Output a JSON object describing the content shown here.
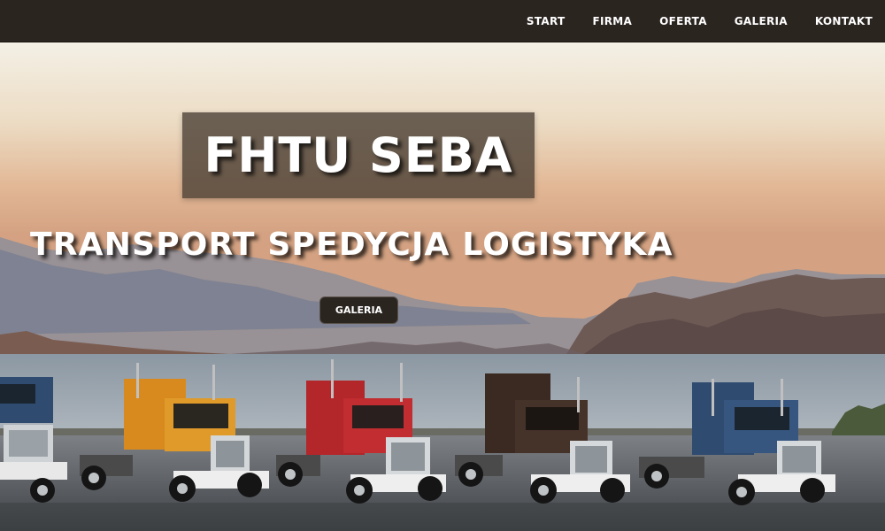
{
  "nav": {
    "items": [
      {
        "label": "START"
      },
      {
        "label": "FIRMA"
      },
      {
        "label": "OFERTA"
      },
      {
        "label": "GALERIA"
      },
      {
        "label": "KONTAKT"
      }
    ]
  },
  "hero": {
    "title": "FHTU SEBA",
    "subtitle": "TRANSPORT SPEDYCJA LOGISTYKA",
    "button_label": "GALERIA",
    "image": "trucks-by-lake-photo"
  },
  "colors": {
    "nav_bg": "#2b2520",
    "title_box_bg": "#463c32",
    "text": "#ffffff",
    "truck_colors": [
      "#2f4c70",
      "#d98a1e",
      "#b3262a",
      "#3a2a22",
      "#2f4c70"
    ]
  }
}
